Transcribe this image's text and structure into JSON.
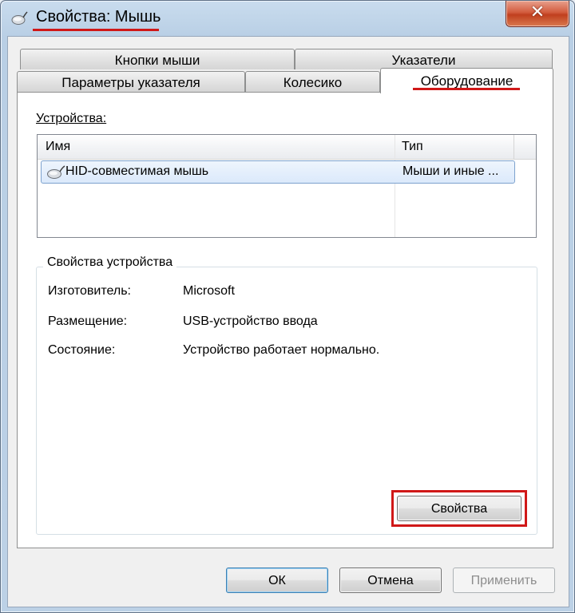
{
  "window": {
    "title": "Свойства: Мышь",
    "close_label": "✕"
  },
  "tabs": {
    "row_back": [
      "Кнопки мыши",
      "Указатели"
    ],
    "row_front": [
      "Параметры указателя",
      "Колесико",
      "Оборудование"
    ],
    "active": "Оборудование"
  },
  "devices": {
    "label": "Устройства:",
    "columns": [
      "Имя",
      "Тип"
    ],
    "rows": [
      {
        "name": "HID-совместимая мышь",
        "type": "Мыши и иные ..."
      }
    ]
  },
  "device_properties": {
    "title": "Свойства устройства",
    "items": [
      {
        "label": "Изготовитель:",
        "value": "Microsoft"
      },
      {
        "label": "Размещение:",
        "value": "USB-устройство ввода"
      },
      {
        "label": "Состояние:",
        "value": "Устройство работает нормально."
      }
    ],
    "properties_button": "Свойства"
  },
  "footer": {
    "ok": "ОК",
    "cancel": "Отмена",
    "apply": "Применить"
  },
  "colors": {
    "highlight": "#d01818",
    "title_bar": "#c9dcee",
    "close_button": "#c03f1e"
  },
  "icons": {
    "title": "mouse-icon",
    "row": "mouse-icon"
  }
}
